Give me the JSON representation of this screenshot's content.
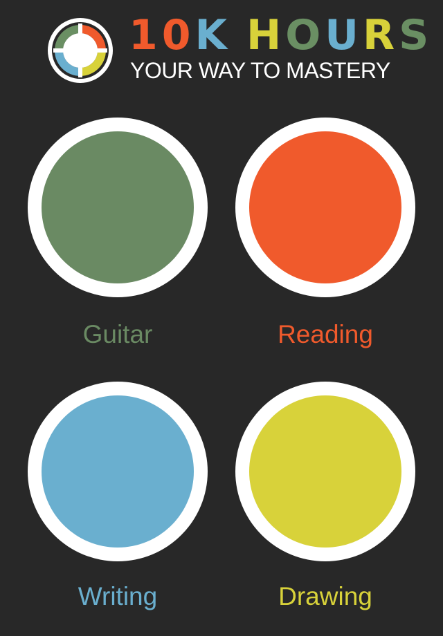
{
  "header": {
    "title_letters": [
      {
        "char": "1",
        "color": "#f05a2c"
      },
      {
        "char": "0",
        "color": "#f05a2c"
      },
      {
        "char": "K",
        "color": "#6aafcf"
      },
      {
        "char": "H",
        "color": "#d8d23a"
      },
      {
        "char": "O",
        "color": "#6a8f63"
      },
      {
        "char": "U",
        "color": "#6aafcf"
      },
      {
        "char": "R",
        "color": "#d8d23a"
      },
      {
        "char": "S",
        "color": "#6a8f63"
      }
    ],
    "subtitle": "YOUR WAY TO MASTERY",
    "logo_icon": "progress-ring-logo-icon"
  },
  "skills": [
    {
      "label": "Guitar",
      "color": "#6a8a63"
    },
    {
      "label": "Reading",
      "color": "#f05a2c"
    },
    {
      "label": "Writing",
      "color": "#6aafcf"
    },
    {
      "label": "Drawing",
      "color": "#d8d23a"
    }
  ]
}
